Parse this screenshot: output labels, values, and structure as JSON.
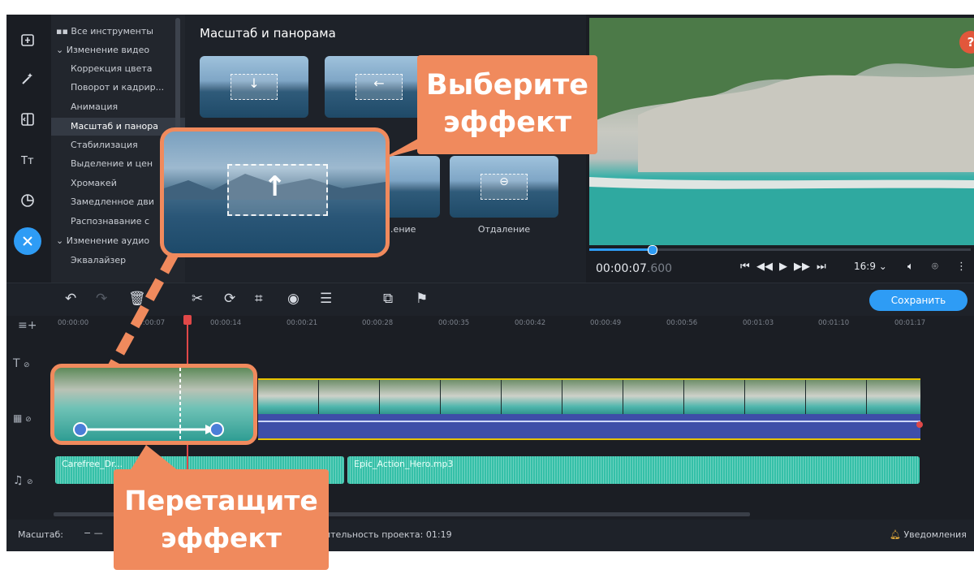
{
  "toolbar": {
    "icons": [
      "import-icon",
      "magic-wand-icon",
      "transitions-icon",
      "titles-icon",
      "stickers-icon",
      "tools-icon"
    ]
  },
  "categories": {
    "items": [
      {
        "label": "Все инструменты",
        "type": "group-grid"
      },
      {
        "label": "Изменение видео",
        "type": "group"
      },
      {
        "label": "Коррекция цвета"
      },
      {
        "label": "Поворот и кадрир..."
      },
      {
        "label": "Анимация"
      },
      {
        "label": "Масштаб и панора",
        "selected": true
      },
      {
        "label": "Стабилизация"
      },
      {
        "label": "Выделение и цен"
      },
      {
        "label": "Хромакей"
      },
      {
        "label": "Замедленное дви"
      },
      {
        "label": "Распознавание с"
      },
      {
        "label": "Изменение аудио",
        "type": "group"
      },
      {
        "label": "Эквалайзер"
      }
    ]
  },
  "gallery": {
    "title": "Масштаб и панорама",
    "visible_labels": [
      "…ение",
      "Отдаление"
    ]
  },
  "preview": {
    "help_label": "?",
    "time_main": "00:00:07",
    "time_ms": ".600",
    "aspect": "16:9",
    "aspect_caret": "⌄",
    "transport": [
      "⏮",
      "◀◀",
      "▶",
      "▶▶",
      "⏭"
    ],
    "playback_progress": 0.16
  },
  "timeline": {
    "save_label": "Сохранить",
    "ruler": [
      "00:00:00",
      "00:00:07",
      "00:00:14",
      "00:00:21",
      "00:00:28",
      "00:00:35",
      "00:00:42",
      "00:00:49",
      "00:00:56",
      "00:01:03",
      "00:01:10",
      "00:01:17"
    ],
    "audio_clips": [
      {
        "label": "Carefree_Dr..."
      },
      {
        "label": "Epic_Action_Hero.mp3"
      }
    ]
  },
  "status": {
    "zoom_label": "Масштаб:",
    "duration_text": "ительность проекта: 01:19",
    "notifications": "Уведомления"
  },
  "overlay": {
    "choose_line1": "Выберите",
    "choose_line2": "эффект",
    "drag_line1": "Перетащите",
    "drag_line2": "эффект"
  },
  "colors": {
    "accent": "#2e9cf5",
    "callout": "#f08a5d",
    "playhead": "#e04848",
    "clip_border": "#e8c300",
    "audio": "#35c0a8"
  }
}
